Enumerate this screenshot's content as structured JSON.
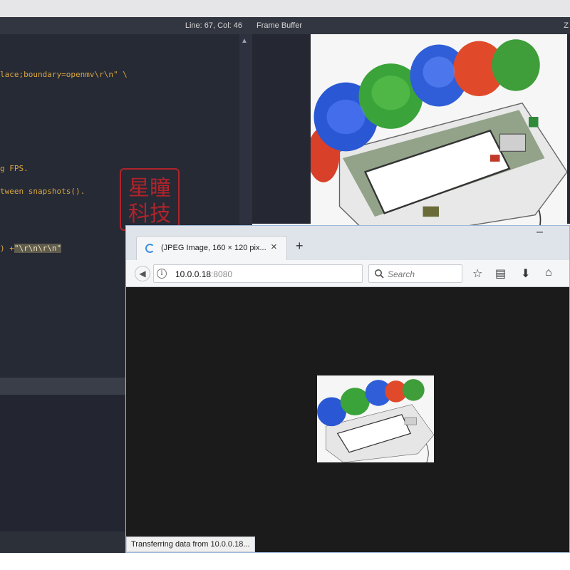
{
  "editor": {
    "status": "Line: 67, Col: 46",
    "code_lines": [
      "lace;boundary=openmv\\r\\n\" \\",
      "g FPS.",
      "tween snapshots().",
      ") +"
    ],
    "highlight": "\"\\r\\n\\r\\n\""
  },
  "frame_buffer": {
    "title": "Frame Buffer",
    "zoom_label": "Z"
  },
  "watermark": {
    "text_top": "星瞳",
    "text_bottom": "科技"
  },
  "browser": {
    "tab_title": "(JPEG Image, 160 × 120 pix...",
    "url_host": "10.0.0.18",
    "url_port": ":8080",
    "search_placeholder": "Search",
    "status_text": "Transferring data from 10.0.0.18..."
  },
  "icons": {
    "back": "back-arrow-icon",
    "info": "info-icon",
    "clear": "clear-x-icon",
    "search": "search-icon",
    "star": "star-icon",
    "reader": "reader-view-icon",
    "download": "download-icon",
    "home": "home-icon"
  },
  "colors": {
    "editor_bg": "#262a35",
    "code_orange": "#d9a640",
    "stamp_red": "#b0232a",
    "browser_bg": "#1b1b1b",
    "spinner_blue": "#3c8de0"
  }
}
